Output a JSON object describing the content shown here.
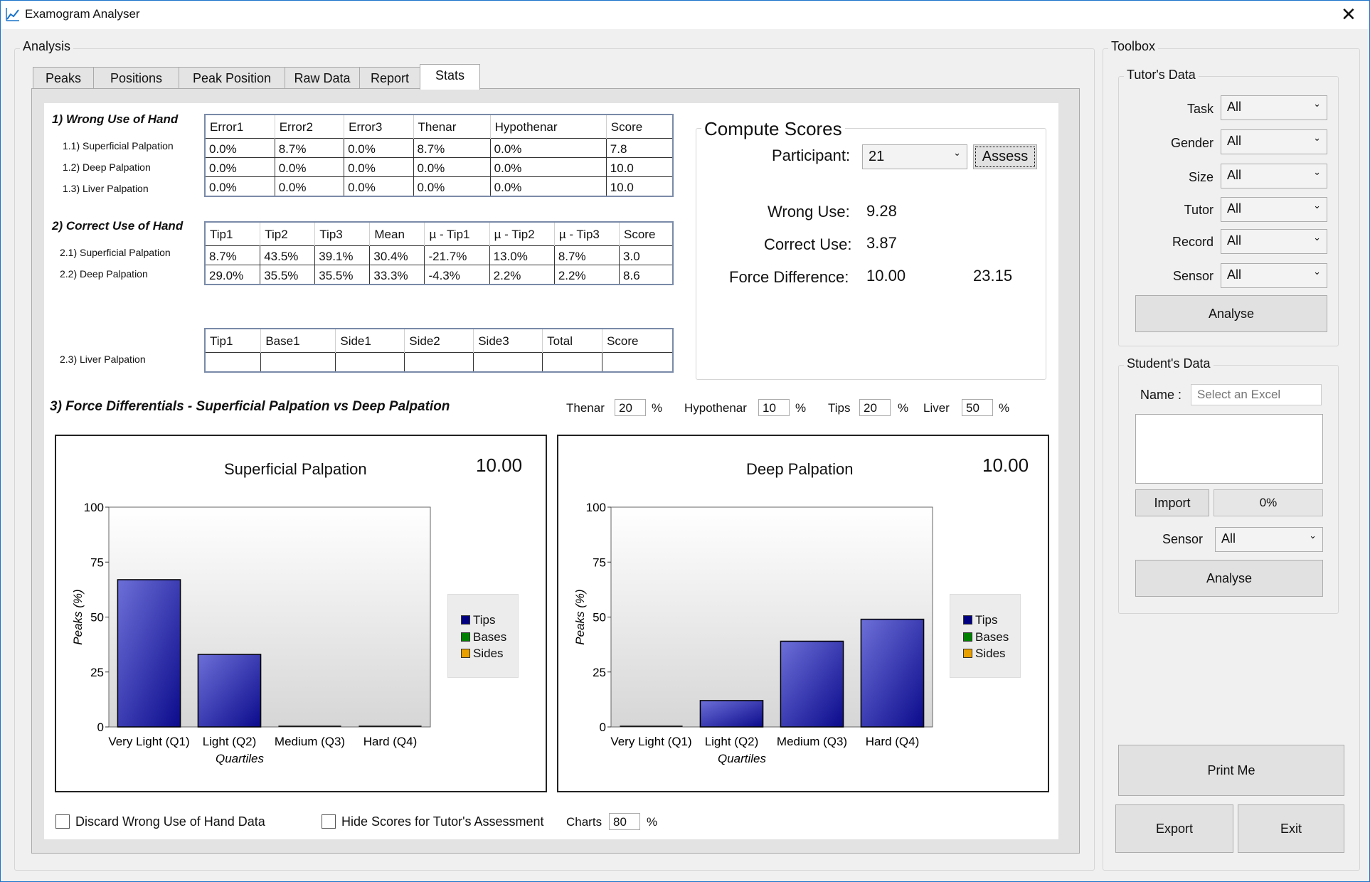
{
  "window": {
    "title": "Examogram Analyser",
    "close_glyph": "✕"
  },
  "analysis": {
    "group_title": "Analysis",
    "tabs": [
      {
        "label": "Peaks"
      },
      {
        "label": "Positions"
      },
      {
        "label": "Peak Position"
      },
      {
        "label": "Raw Data"
      },
      {
        "label": "Report"
      },
      {
        "label": "Stats"
      }
    ],
    "active_tab": "Stats",
    "section1": {
      "title": "1) Wrong Use of Hand",
      "rows": [
        "1.1) Superficial Palpation",
        "1.2) Deep Palpation",
        "1.3) Liver Palpation"
      ],
      "headers": [
        "Error1",
        "Error2",
        "Error3",
        "Thenar",
        "Hypothenar",
        "Score"
      ],
      "data": [
        [
          "0.0%",
          "8.7%",
          "0.0%",
          "8.7%",
          "0.0%",
          "7.8"
        ],
        [
          "0.0%",
          "0.0%",
          "0.0%",
          "0.0%",
          "0.0%",
          "10.0"
        ],
        [
          "0.0%",
          "0.0%",
          "0.0%",
          "0.0%",
          "0.0%",
          "10.0"
        ]
      ]
    },
    "section2": {
      "title": "2) Correct Use of Hand",
      "rows": [
        "2.1) Superficial Palpation",
        "2.2) Deep Palpation"
      ],
      "headers": [
        "Tip1",
        "Tip2",
        "Tip3",
        "Mean",
        "µ - Tip1",
        "µ - Tip2",
        "µ - Tip3",
        "Score"
      ],
      "data": [
        [
          "8.7%",
          "43.5%",
          "39.1%",
          "30.4%",
          "-21.7%",
          "13.0%",
          "8.7%",
          "3.0"
        ],
        [
          "29.0%",
          "35.5%",
          "35.5%",
          "33.3%",
          "-4.3%",
          "2.2%",
          "2.2%",
          "8.6"
        ]
      ],
      "liver_row": "2.3) Liver Palpation",
      "liver_headers": [
        "Tip1",
        "Base1",
        "Side1",
        "Side2",
        "Side3",
        "Total",
        "Score"
      ]
    },
    "compute": {
      "title": "Compute Scores",
      "participant_label": "Participant:",
      "participant_value": "21",
      "assess_label": "Assess",
      "wrong_label": "Wrong Use:",
      "wrong_value": "9.28",
      "correct_label": "Correct Use:",
      "correct_value": "3.87",
      "force_label": "Force Difference:",
      "force_value": "10.00",
      "force_value2": "23.15"
    },
    "section3": {
      "title": "3) Force Differentials - Superficial Palpation vs Deep Palpation",
      "thenar_label": "Thenar",
      "thenar_value": "20",
      "hypothenar_label": "Hypothenar",
      "hypothenar_value": "10",
      "tips_label": "Tips",
      "tips_value": "20",
      "liver_label": "Liver",
      "liver_value": "50",
      "pct": "%"
    },
    "bottom": {
      "discard_label": "Discard Wrong Use of Hand Data",
      "hide_label": "Hide Scores for Tutor's Assessment",
      "charts_label": "Charts",
      "charts_value": "80",
      "pct": "%"
    }
  },
  "chart_data": [
    {
      "type": "bar",
      "title": "Superficial Palpation",
      "score": "10.00",
      "categories": [
        "Very Light (Q1)",
        "Light (Q2)",
        "Medium (Q3)",
        "Hard (Q4)"
      ],
      "series": [
        {
          "name": "Tips",
          "values": [
            67,
            33,
            0,
            0
          ]
        }
      ],
      "legend": [
        "Tips",
        "Bases",
        "Sides"
      ],
      "legend_colors": [
        "#000080",
        "#008000",
        "#e8a000"
      ],
      "xlabel": "Quartiles",
      "ylabel": "Peaks (%)",
      "ylim": [
        0,
        100
      ],
      "yticks": [
        "0",
        "25",
        "50",
        "75",
        "100"
      ],
      "legend_position": "right"
    },
    {
      "type": "bar",
      "title": "Deep Palpation",
      "score": "10.00",
      "categories": [
        "Very Light (Q1)",
        "Light (Q2)",
        "Medium (Q3)",
        "Hard (Q4)"
      ],
      "series": [
        {
          "name": "Tips",
          "values": [
            0,
            12,
            39,
            49
          ]
        }
      ],
      "legend": [
        "Tips",
        "Bases",
        "Sides"
      ],
      "legend_colors": [
        "#000080",
        "#008000",
        "#e8a000"
      ],
      "xlabel": "Quartiles",
      "ylabel": "Peaks (%)",
      "ylim": [
        0,
        100
      ],
      "yticks": [
        "0",
        "25",
        "50",
        "75",
        "100"
      ],
      "legend_position": "right"
    }
  ],
  "toolbox": {
    "group_title": "Toolbox",
    "tutor": {
      "title": "Tutor's Data",
      "fields": [
        {
          "label": "Task",
          "value": "All"
        },
        {
          "label": "Gender",
          "value": "All"
        },
        {
          "label": "Size",
          "value": "All"
        },
        {
          "label": "Tutor",
          "value": "All"
        },
        {
          "label": "Record",
          "value": "All"
        },
        {
          "label": "Sensor",
          "value": "All"
        }
      ],
      "analyse_label": "Analyse"
    },
    "student": {
      "title": "Student's Data",
      "name_label": "Name :",
      "name_placeholder": "Select an Excel",
      "import_label": "Import",
      "progress": "0%",
      "sensor_label": "Sensor",
      "sensor_value": "All",
      "analyse_label": "Analyse"
    },
    "print_label": "Print Me",
    "export_label": "Export",
    "exit_label": "Exit"
  }
}
